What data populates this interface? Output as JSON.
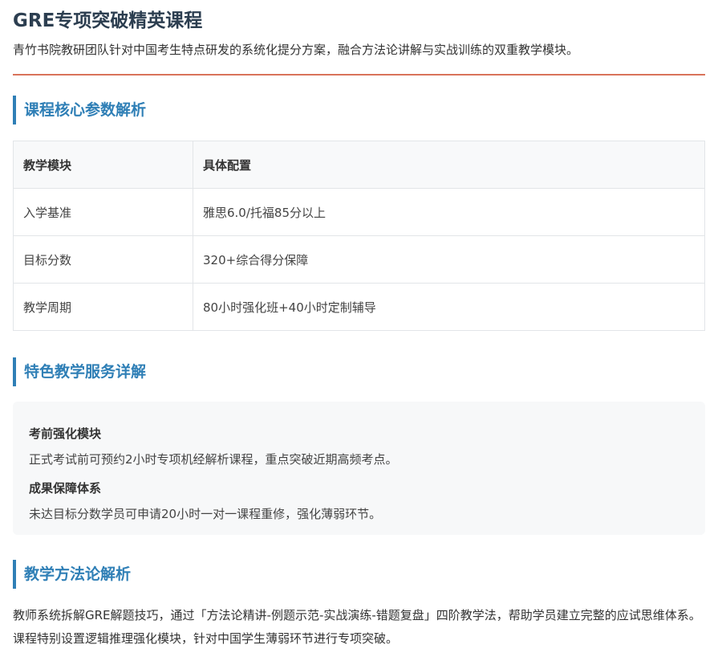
{
  "page": {
    "title": "GRE专项突破精英课程",
    "intro": "青竹书院教研团队针对中国考生特点研发的系统化提分方案，融合方法论讲解与实战训练的双重教学模块。"
  },
  "params_section": {
    "heading": "课程核心参数解析",
    "columns": [
      "教学模块",
      "具体配置"
    ],
    "rows": [
      [
        "入学基准",
        "雅思6.0/托福85分以上"
      ],
      [
        "目标分数",
        "320+综合得分保障"
      ],
      [
        "教学周期",
        "80小时强化班+40小时定制辅导"
      ]
    ]
  },
  "services_section": {
    "heading": "特色教学服务详解",
    "items": [
      {
        "title": "考前强化模块",
        "desc": "正式考试前可预约2小时专项机经解析课程，重点突破近期高频考点。"
      },
      {
        "title": "成果保障体系",
        "desc": "未达目标分数学员可申请20小时一对一课程重修，强化薄弱环节。"
      }
    ]
  },
  "method_section": {
    "heading": "教学方法论解析",
    "text": "教师系统拆解GRE解题技巧，通过「方法论精讲-例题示范-实战演练-错题复盘」四阶教学法，帮助学员建立完整的应试思维体系。课程特别设置逻辑推理强化模块，针对中国学生薄弱环节进行专项突破。"
  },
  "colors": {
    "accent": "#2f7fb6",
    "rule": "#d9735a",
    "title": "#2c3e50"
  }
}
